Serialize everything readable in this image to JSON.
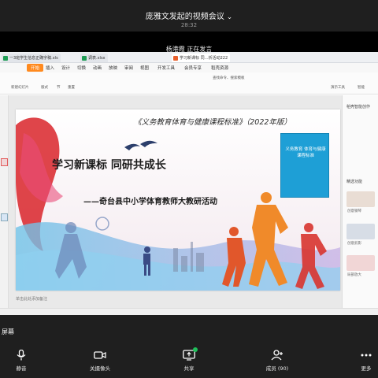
{
  "meeting": {
    "title": "庞雅文发起的视频会议",
    "time": "28:32",
    "speaker": "杨港霞 正在发言",
    "share_label": "屏幕"
  },
  "screen": {
    "file_tabs": [
      {
        "label": "一3班学生信息正确字稿.xls",
        "color": "#1f9d55"
      },
      {
        "label": "调表.xlsx",
        "color": "#1f9d55"
      },
      {
        "label": "学习新课标 同…析活动222",
        "color": "#e8602c"
      }
    ],
    "menu": [
      "开始",
      "插入",
      "设计",
      "切换",
      "动画",
      "放映",
      "审阅",
      "视图",
      "开发工具",
      "会员专享",
      "稻壳资源"
    ],
    "toolbar": [
      "新建幻灯片",
      "版式",
      "节",
      "重置",
      "查找命令、搜索模板",
      "演示工具",
      "智能"
    ],
    "notes_placeholder": "单击此处添加备注",
    "slide": {
      "header": "《义务教育体育与健康课程标准》（2022年版）",
      "title": "学习新课标 同研共成长",
      "subtitle": "——奇台县中小学体育教师大教研活动",
      "book_title": "义务教育 体育与健康课程标准"
    },
    "right_pane": {
      "title": "稻壳智能创作",
      "section": "精选功能",
      "item1": "创意钢琴",
      "item2": "创意剪影",
      "item3": "局部放大"
    }
  },
  "controls": [
    {
      "label": "静音",
      "icon": "mic-icon"
    },
    {
      "label": "关摄像头",
      "icon": "camera-icon"
    },
    {
      "label": "共享",
      "icon": "share-screen-icon"
    },
    {
      "label": "成员 (90)",
      "icon": "members-icon"
    },
    {
      "label": "更多",
      "icon": "more-icon"
    }
  ],
  "colors": {
    "accent": "#ff8a1f",
    "slide_red": "#d9252a",
    "book_blue": "#1e9fd6",
    "share_badge": "#1fbf5a"
  }
}
